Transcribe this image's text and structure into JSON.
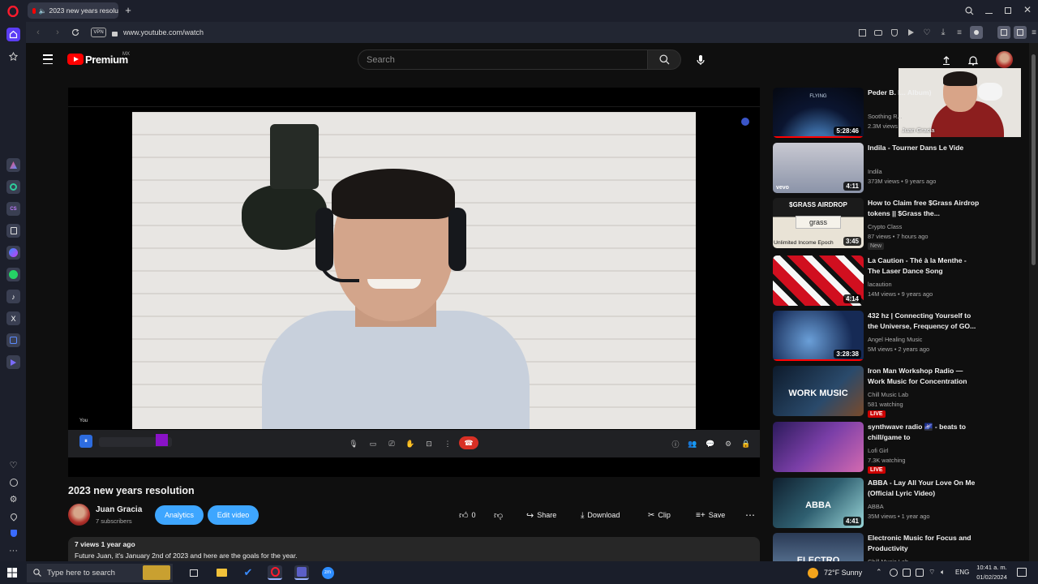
{
  "browser": {
    "tab_title": "2023 new years resolu",
    "url": "www.youtube.com/watch",
    "vpn": "VPN"
  },
  "youtube": {
    "logo": "Premium",
    "logo_region": "MX",
    "search_placeholder": "Search",
    "video": {
      "title": "2023 new years resolution",
      "you_label": "You",
      "overlay_name": "Juan Gracia"
    },
    "channel": {
      "name": "Juan Gracia",
      "subscribers": "7 subscribers"
    },
    "buttons": {
      "analytics": "Analytics",
      "edit": "Edit video",
      "likes": "0",
      "share": "Share",
      "download": "Download",
      "clip": "Clip",
      "save": "Save"
    },
    "description": {
      "meta": "7 views  1 year ago",
      "text": "Future Juan, it's January 2nd of 2023 and here are the goals for the year."
    },
    "recommendations": [
      {
        "title": "Peder B. I... Album)",
        "channel": "Soothing R...",
        "meta": "2.3M views",
        "duration": "5:28:46",
        "thumb_text": "FLYING"
      },
      {
        "title": "Indila - Tourner Dans Le Vide",
        "channel": "Indila",
        "meta": "373M views  •  9 years ago",
        "duration": "4:11",
        "thumb_text": "vevo"
      },
      {
        "title": "How to Claim free $Grass Airdrop tokens || $Grass the...",
        "channel": "Crypto Class",
        "meta": "87 views  •  7 hours ago",
        "duration": "3:45",
        "badge": "New",
        "thumb_text": "$GRASS AIRDROP",
        "thumb_sub": "grass",
        "thumb_caption": "Unlimited Income Epoch"
      },
      {
        "title": "La Caution - Thé à la Menthe - The Laser Dance Song",
        "channel": "lacaution",
        "meta": "14M views  •  9 years ago",
        "duration": "4:14"
      },
      {
        "title": "432 hz | Connecting Yourself to the Universe, Frequency of GO...",
        "channel": "Angel Healing Music",
        "meta": "5M views  •  2 years ago",
        "duration": "3:28:38"
      },
      {
        "title": "Iron Man Workshop Radio — Work Music for Concentration",
        "channel": "Chill Music Lab",
        "meta": "581 watching",
        "badge": "LIVE",
        "thumb_text": "WORK MUSIC"
      },
      {
        "title": "synthwave radio 🌌 - beats to chill/game to",
        "channel": "Lofi Girl",
        "meta": "7.3K watching",
        "badge": "LIVE"
      },
      {
        "title": "ABBA - Lay All Your Love On Me (Official Lyric Video)",
        "channel": "ABBA",
        "meta": "35M views  •  1 year ago",
        "duration": "4:41",
        "thumb_text": "ABBA"
      },
      {
        "title": "Electronic Music for Focus and Productivity",
        "channel": "Chill Music Lab",
        "thumb_text": "ELECTRO"
      }
    ]
  },
  "taskbar": {
    "search_placeholder": "Type here to search",
    "weather": "72°F  Sunny",
    "lang": "ENG",
    "time": "10:41 a. m.",
    "date": "01/02/2024"
  }
}
